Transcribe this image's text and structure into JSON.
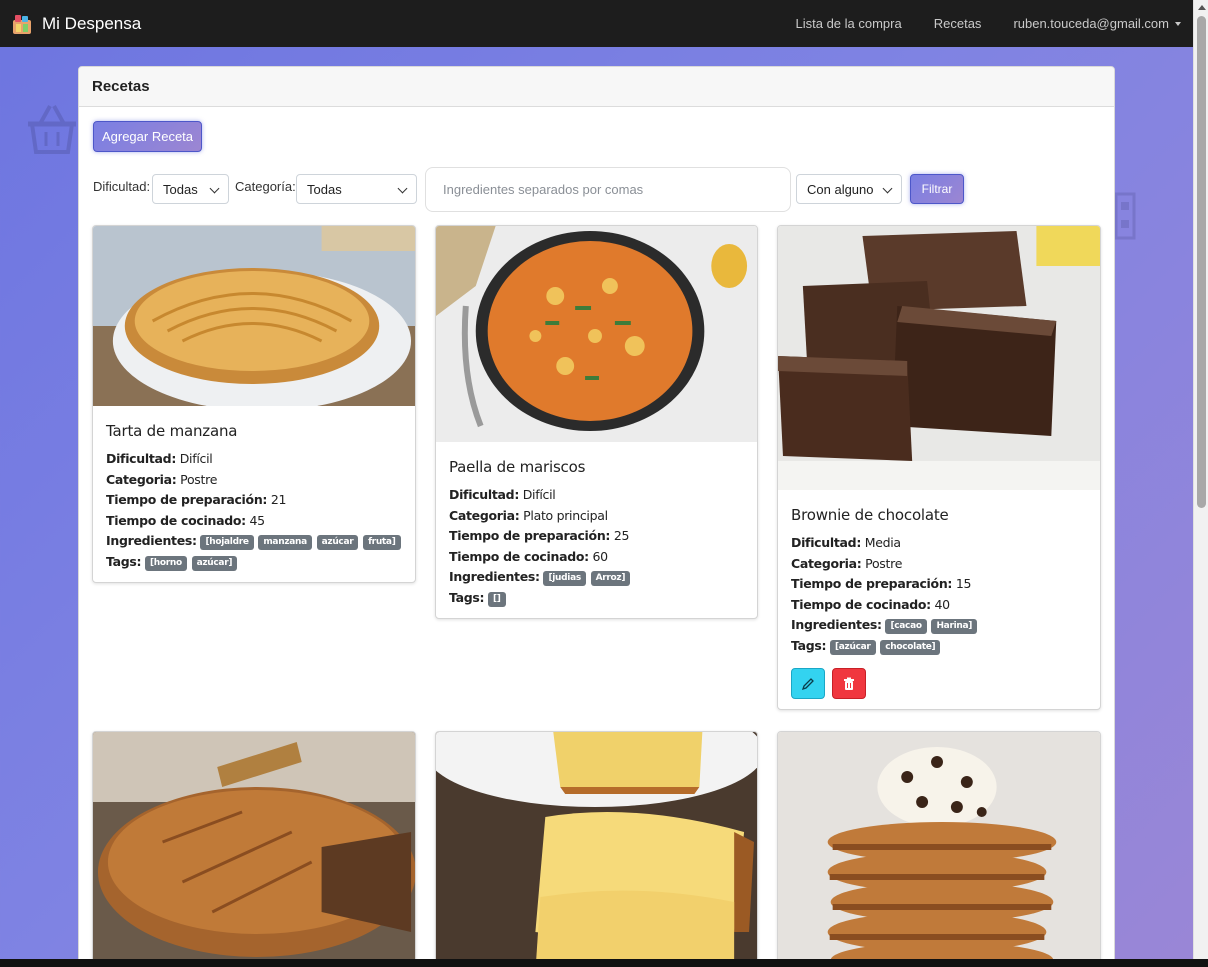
{
  "navbar": {
    "brand": "Mi Despensa",
    "links": [
      "Lista de la compra",
      "Recetas"
    ],
    "user": "ruben.touceda@gmail.com"
  },
  "page": {
    "header": "Recetas",
    "add_button": "Agregar Receta"
  },
  "filters": {
    "difficulty_label": "Dificultad:",
    "difficulty_value": "Todas",
    "category_label": "Categoría:",
    "category_value": "Todas",
    "ingredients_placeholder": "Ingredientes separados por comas",
    "match_value": "Con alguno",
    "filter_button": "Filtrar"
  },
  "labels": {
    "difficulty": "Dificultad:",
    "category": "Categoria:",
    "prep": "Tiempo de preparación:",
    "cook": "Tiempo de cocinado:",
    "ingredients": "Ingredientes:",
    "tags": "Tags:"
  },
  "recipes": [
    {
      "title": "Tarta de manzana",
      "difficulty": "Difícil",
      "category": "Postre",
      "prep": "21",
      "cook": "45",
      "ingredients": [
        "[hojaldre",
        "manzana",
        "azúcar",
        "fruta]"
      ],
      "tags": [
        "[horno",
        "azúcar]"
      ]
    },
    {
      "title": "Paella de mariscos",
      "difficulty": "Difícil",
      "category": "Plato principal",
      "prep": "25",
      "cook": "60",
      "ingredients": [
        "[judias",
        "Arroz]"
      ],
      "tags": [
        "[]"
      ]
    },
    {
      "title": "Brownie de chocolate",
      "difficulty": "Media",
      "category": "Postre",
      "prep": "15",
      "cook": "40",
      "ingredients": [
        "[cacao",
        "Harina]"
      ],
      "tags": [
        "[azúcar",
        "chocolate]"
      ]
    }
  ],
  "colors": {
    "navbar": "#1d1d1d",
    "accent_gradient_start": "#7a7fe3",
    "accent_gradient_end": "#9c86d2",
    "badge": "#6c757d",
    "edit": "#33d3f0",
    "delete": "#f0373f"
  },
  "icons": {
    "brand": "pantry-logo-icon",
    "edit": "pencil-icon",
    "delete": "trash-icon"
  }
}
